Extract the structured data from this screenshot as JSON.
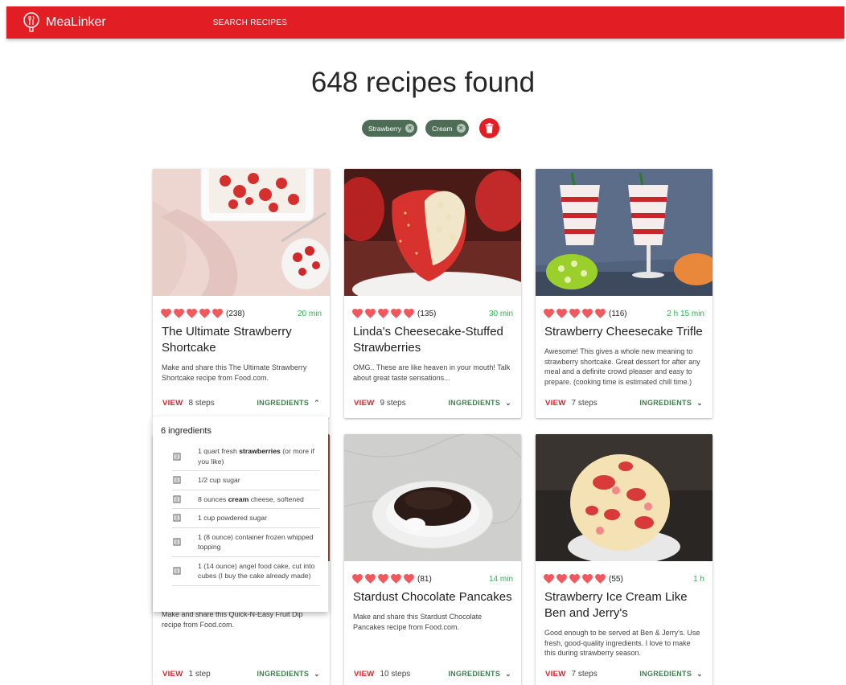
{
  "app": {
    "name": "MeaLinker",
    "nav_search": "SEARCH RECIPES"
  },
  "results": {
    "headline": "648 recipes found"
  },
  "filters": {
    "chips": [
      "Strawberry",
      "Cream"
    ],
    "clear_icon": "trash-icon"
  },
  "colors": {
    "brand_red": "#e21d24",
    "chip_green": "#4e6d57",
    "time_green": "#2bb24c",
    "heart_red": "#f0585c"
  },
  "cards": [
    {
      "rating_count": "(238)",
      "time": "20 min",
      "title": "The Ultimate Strawberry Shortcake",
      "description": "Make and share this The Ultimate Strawberry Shortcake recipe from Food.com.",
      "view": "VIEW",
      "steps": "8 steps",
      "ingredients_label": "INGREDIENTS",
      "expanded": true
    },
    {
      "rating_count": "(135)",
      "time": "30 min",
      "title": "Linda's Cheesecake-Stuffed Strawberries",
      "description": "OMG.. These are like heaven in your mouth! Talk about great taste sensations...",
      "view": "VIEW",
      "steps": "9 steps",
      "ingredients_label": "INGREDIENTS",
      "expanded": false
    },
    {
      "rating_count": "(116)",
      "time": "2 h 15 min",
      "title": "Strawberry Cheesecake Trifle",
      "description": "Awesome! This gives a whole new meaning to strawberry shortcake. Great dessert for after any meal and a definite crowd pleaser and easy to prepare. (cooking time is estimated chill time.)",
      "view": "VIEW",
      "steps": "7 steps",
      "ingredients_label": "INGREDIENTS",
      "expanded": false
    },
    {
      "description": "Make and share this Quick-N-Easy Fruit Dip recipe from Food.com.",
      "view": "VIEW",
      "steps": "1 step",
      "ingredients_label": "INGREDIENTS",
      "expanded": false
    },
    {
      "rating_count": "(81)",
      "time": "14 min",
      "title": "Stardust Chocolate Pancakes",
      "description": "Make and share this Stardust Chocolate Pancakes recipe from Food.com.",
      "view": "VIEW",
      "steps": "10 steps",
      "ingredients_label": "INGREDIENTS",
      "expanded": false
    },
    {
      "rating_count": "(55)",
      "time": "1 h",
      "title": "Strawberry Ice Cream Like Ben and Jerry's",
      "description": "Good enough to be served at Ben & Jerry's. Use fresh, good-quality ingredients. I love to make this during strawberry season.",
      "view": "VIEW",
      "steps": "7 steps",
      "ingredients_label": "INGREDIENTS",
      "expanded": false
    }
  ],
  "ingredients_panel": {
    "heading": "6 ingredients",
    "items": [
      {
        "pre": "1 quart fresh ",
        "bold": "strawberries",
        "post": " (or more if you like)"
      },
      {
        "pre": "1/2 cup sugar",
        "bold": "",
        "post": ""
      },
      {
        "pre": "8 ounces ",
        "bold": "cream",
        "post": " cheese, softened"
      },
      {
        "pre": "1 cup powdered sugar",
        "bold": "",
        "post": ""
      },
      {
        "pre": "1 (8 ounce) container frozen whipped topping",
        "bold": "",
        "post": ""
      },
      {
        "pre": "1 (14 ounce) angel food cake, cut into cubes (I buy the cake already made)",
        "bold": "",
        "post": ""
      }
    ]
  }
}
